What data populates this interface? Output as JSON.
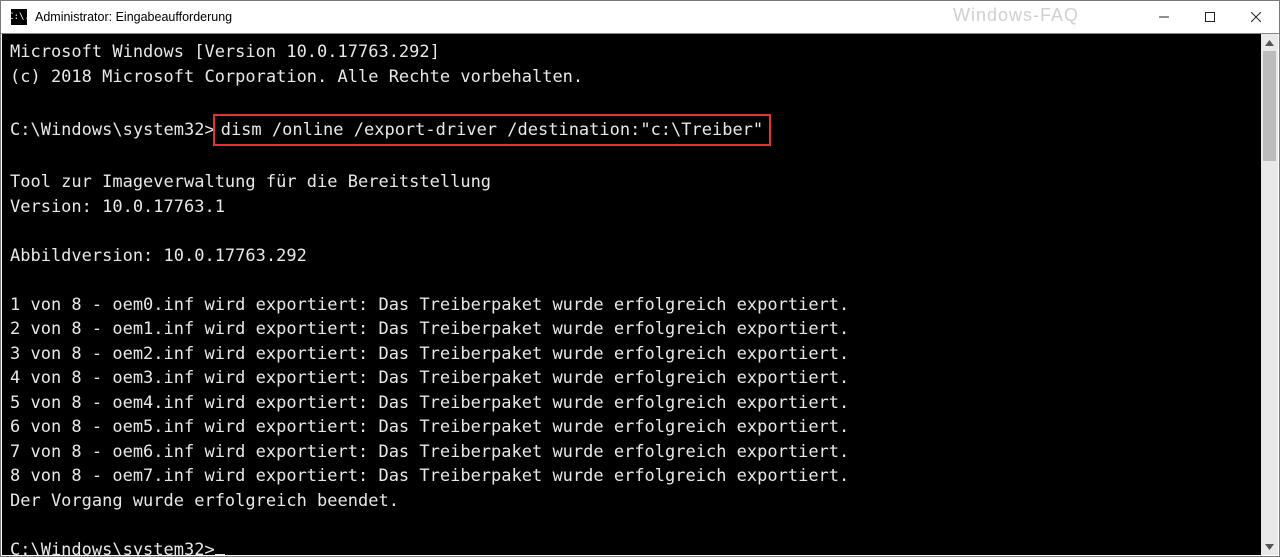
{
  "titlebar": {
    "icon_glyph": "C:\\.",
    "title": "Administrator: Eingabeaufforderung",
    "watermark": "Windows-FAQ"
  },
  "terminal": {
    "header_line1": "Microsoft Windows [Version 10.0.17763.292]",
    "header_line2": "(c) 2018 Microsoft Corporation. Alle Rechte vorbehalten.",
    "prompt1_prefix": "C:\\Windows\\system32>",
    "command_highlighted": "dism /online /export-driver /destination:\"c:\\Treiber\"",
    "tool_line": "Tool zur Imageverwaltung für die Bereitstellung",
    "tool_version": "Version: 10.0.17763.1",
    "image_version": "Abbildversion: 10.0.17763.292",
    "exports": [
      "1 von 8 - oem0.inf wird exportiert: Das Treiberpaket wurde erfolgreich exportiert.",
      "2 von 8 - oem1.inf wird exportiert: Das Treiberpaket wurde erfolgreich exportiert.",
      "3 von 8 - oem2.inf wird exportiert: Das Treiberpaket wurde erfolgreich exportiert.",
      "4 von 8 - oem3.inf wird exportiert: Das Treiberpaket wurde erfolgreich exportiert.",
      "5 von 8 - oem4.inf wird exportiert: Das Treiberpaket wurde erfolgreich exportiert.",
      "6 von 8 - oem5.inf wird exportiert: Das Treiberpaket wurde erfolgreich exportiert.",
      "7 von 8 - oem6.inf wird exportiert: Das Treiberpaket wurde erfolgreich exportiert.",
      "8 von 8 - oem7.inf wird exportiert: Das Treiberpaket wurde erfolgreich exportiert."
    ],
    "complete_line": "Der Vorgang wurde erfolgreich beendet.",
    "prompt2": "C:\\Windows\\system32>"
  }
}
